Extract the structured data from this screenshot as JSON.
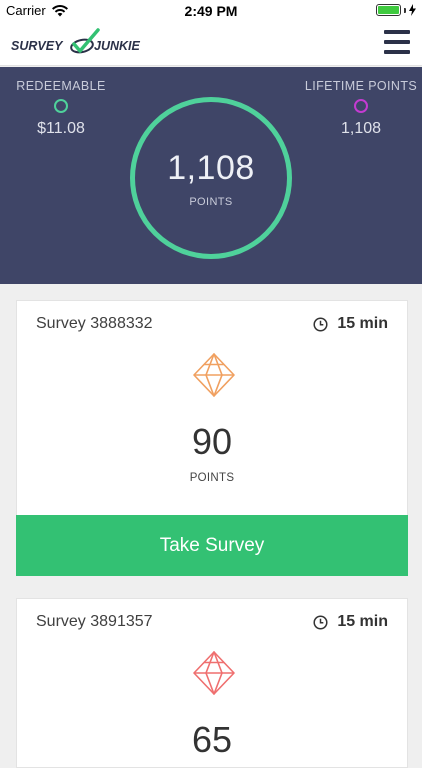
{
  "status_bar": {
    "carrier": "Carrier",
    "time": "2:49 PM",
    "battery_color": "#3fca3f"
  },
  "header": {
    "logo_text_left": "SURVEY",
    "logo_text_right": "JUNKIE",
    "menu_icon": "hamburger-menu-icon"
  },
  "stats": {
    "redeemable_label": "REDEEMABLE",
    "redeemable_value": "$11.08",
    "total_points": "1,108",
    "total_points_label": "POINTS",
    "lifetime_label": "LIFETIME POINTS",
    "lifetime_value": "1,108",
    "colors": {
      "background": "#3f4567",
      "ring": "#4fd19b",
      "lifetime_dot": "#c43bd1"
    }
  },
  "surveys": [
    {
      "title": "Survey 3888332",
      "duration": "15 min",
      "points": "90",
      "points_label": "POINTS",
      "gem_color": "#f0a060",
      "button_label": "Take Survey"
    },
    {
      "title": "Survey 3891357",
      "duration": "15 min",
      "points": "65",
      "gem_color": "#ef6f6f"
    }
  ],
  "colors": {
    "accent_green": "#33c173"
  }
}
